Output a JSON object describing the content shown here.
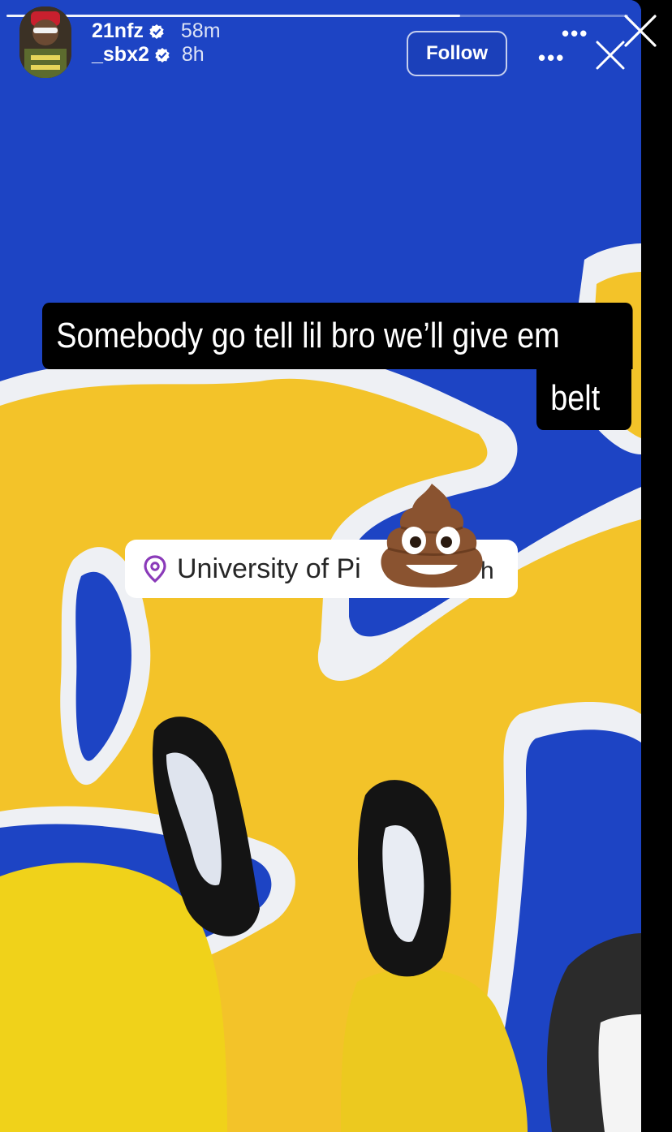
{
  "story": {
    "progress": 0.73,
    "users": [
      {
        "username": "21nfz",
        "time": "58m",
        "verified": true
      },
      {
        "username": "_sbx2",
        "time": "8h",
        "verified": true
      }
    ],
    "follow_label": "Follow",
    "more_label": "•••",
    "caption_line1": "Somebody go tell lil bro we’ll give em",
    "caption_line2": "belt",
    "location_text": "University of Pi",
    "location_end": "h",
    "sticker": "poop-emoji"
  },
  "colors": {
    "court_blue": "#1d44c4",
    "court_gold": "#f3c329",
    "caption_bg": "#000000",
    "pin_purple": "#8a3ab9"
  }
}
